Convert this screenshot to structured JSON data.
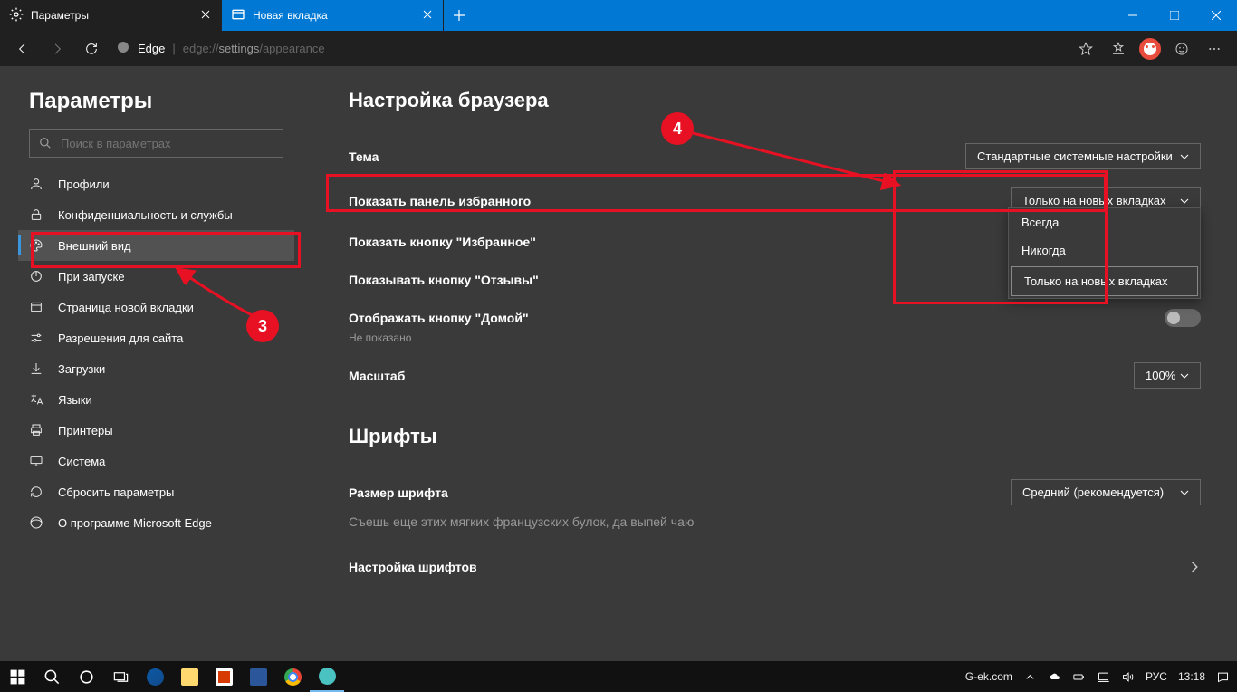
{
  "tabs": [
    {
      "title": "Параметры",
      "active": true
    },
    {
      "title": "Новая вкладка",
      "active": false
    }
  ],
  "address": {
    "label": "Edge",
    "url_prefix": "edge://",
    "url_mid": "settings",
    "url_suffix": "/appearance"
  },
  "sidebar": {
    "title": "Параметры",
    "search_placeholder": "Поиск в параметрах",
    "items": [
      {
        "label": "Профили"
      },
      {
        "label": "Конфиденциальность и службы"
      },
      {
        "label": "Внешний вид",
        "active": true
      },
      {
        "label": "При запуске"
      },
      {
        "label": "Страница новой вкладки"
      },
      {
        "label": "Разрешения для сайта"
      },
      {
        "label": "Загрузки"
      },
      {
        "label": "Языки"
      },
      {
        "label": "Принтеры"
      },
      {
        "label": "Система"
      },
      {
        "label": "Сбросить параметры"
      },
      {
        "label": "О программе Microsoft Edge"
      }
    ]
  },
  "main": {
    "section1": "Настройка браузера",
    "theme": {
      "label": "Тема",
      "value": "Стандартные системные настройки"
    },
    "fav_panel": {
      "label": "Показать панель избранного",
      "value": "Только на новых вкладках",
      "options": [
        "Всегда",
        "Никогда",
        "Только на новых вкладках"
      ]
    },
    "fav_btn": {
      "label": "Показать кнопку \"Избранное\""
    },
    "feedback_btn": {
      "label": "Показывать кнопку \"Отзывы\""
    },
    "home_btn": {
      "label": "Отображать кнопку \"Домой\"",
      "sub": "Не показано"
    },
    "zoom": {
      "label": "Масштаб",
      "value": "100%"
    },
    "section2": "Шрифты",
    "font_size": {
      "label": "Размер шрифта",
      "value": "Средний (рекомендуется)",
      "sample": "Съешь еще этих мягких французских булок, да выпей чаю"
    },
    "font_custom": {
      "label": "Настройка шрифтов"
    }
  },
  "markers": {
    "n3": "3",
    "n4": "4"
  },
  "taskbar": {
    "site": "G-ek.com",
    "lang": "РУС",
    "time": "13:18"
  }
}
